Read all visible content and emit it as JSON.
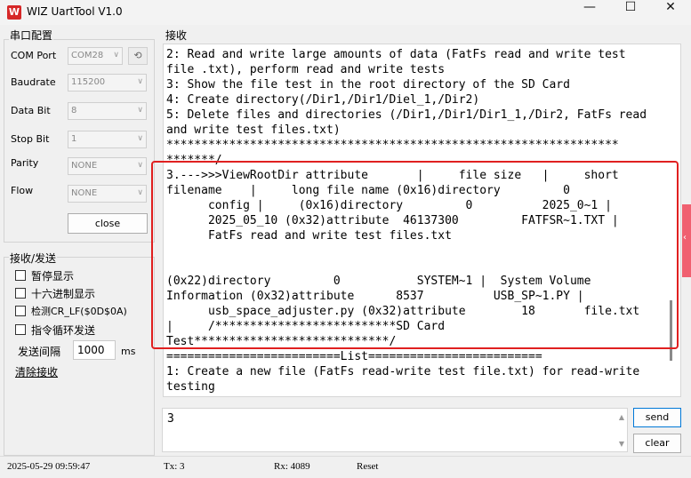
{
  "window": {
    "logo": "W",
    "title": "WIZ UartTool V1.0",
    "minimize": "—",
    "maximize": "☐",
    "close": "✕"
  },
  "serial_config": {
    "title": "串口配置",
    "port_label": "COM Port",
    "port_value": "COM28",
    "baud_label": "Baudrate",
    "baud_value": "115200",
    "databit_label": "Data Bit",
    "databit_value": "8",
    "stopbit_label": "Stop Bit",
    "stopbit_value": "1",
    "parity_label": "Parity",
    "parity_value": "NONE",
    "flow_label": "Flow",
    "flow_value": "NONE",
    "close_label": "close"
  },
  "recv_send": {
    "title": "接收/发送",
    "pause_label": "暂停显示",
    "hex_label": "十六进制显示",
    "crlf_label": "检测CR_LF($0D$0A)",
    "loop_label": "指令循环发送",
    "interval_label": "发送间隔",
    "interval_value": "1000",
    "interval_unit": "ms",
    "clear_recv_label": "清除接收"
  },
  "receive": {
    "title": "接收",
    "text": "2: Read and write large amounts of data (FatFs read and write test\nfile .txt), perform read and write tests\n3: Show the file test in the root directory of the SD Card\n4: Create directory(/Dir1,/Dir1/Diel_1,/Dir2)\n5: Delete files and directories (/Dir1,/Dir1/Dir1_1,/Dir2, FatFs read\nand write test files.txt)\n*****************************************************************\n*******/\n3.--->>>ViewRootDir attribute       |     file size   |     short\nfilename    |     long file name (0x16)directory         0\n      config |     (0x16)directory         0          2025_0~1 |\n      2025_05_10 (0x32)attribute  46137300         FATFSR~1.TXT |\n      FatFs read and write test files.txt\n\n\n(0x22)directory         0           SYSTEM~1 |  System Volume\nInformation (0x32)attribute      8537          USB_SP~1.PY |\n      usb_space_adjuster.py (0x32)attribute        18       file.txt\n|     /**************************SD Card\nTest****************************/\n=========================List=========================\n1: Create a new file (FatFs read-write test file.txt) for read-write\ntesting"
  },
  "send": {
    "text": "3",
    "send_label": "send",
    "clear_label": "clear"
  },
  "status": {
    "timestamp": "2025-05-29 09:59:47",
    "tx": "Tx: 3",
    "rx": "Rx: 4089",
    "reset_label": "Reset"
  },
  "icons": {
    "refresh": "⟲",
    "dropdown": "∨",
    "scroll_up": "▲",
    "scroll_down": "▼",
    "side_tab": "‹"
  }
}
